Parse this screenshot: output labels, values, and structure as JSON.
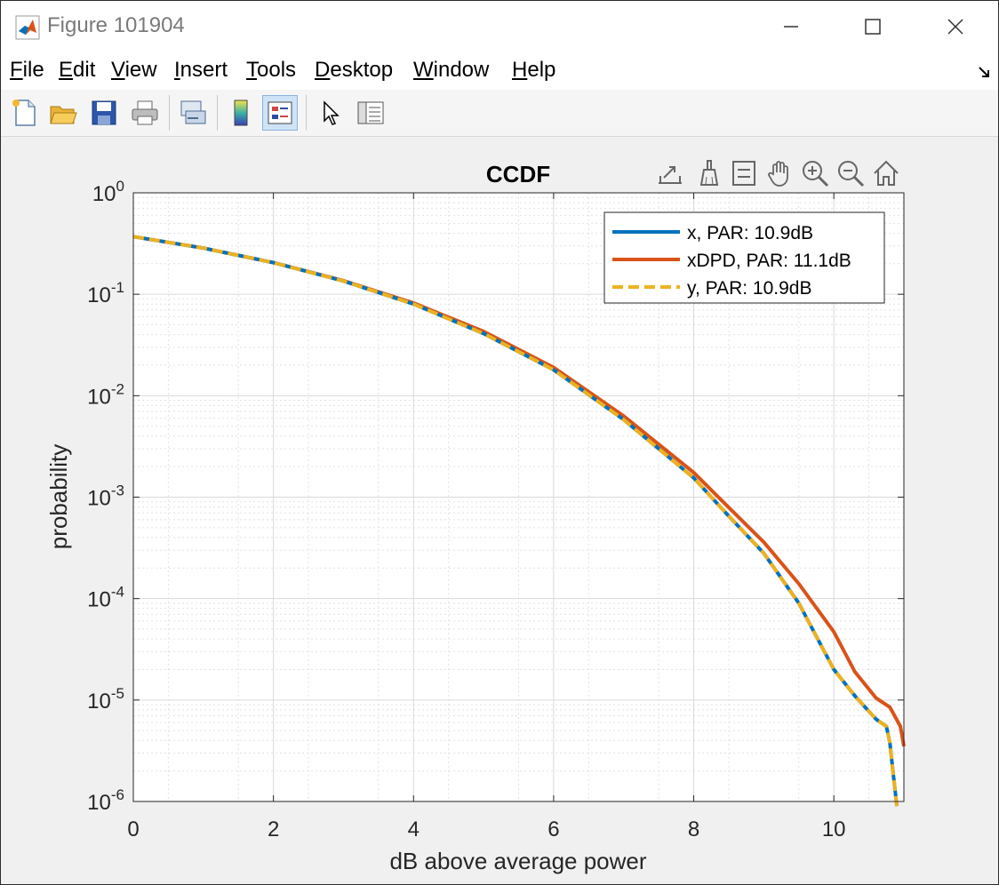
{
  "window": {
    "title": "Figure 101904",
    "controls": {
      "minimize": "minimize",
      "maximize": "maximize",
      "close": "close"
    }
  },
  "menu": [
    {
      "label": "File",
      "u": "F",
      "rest": "ile"
    },
    {
      "label": "Edit",
      "u": "E",
      "rest": "dit"
    },
    {
      "label": "View",
      "u": "V",
      "rest": "iew"
    },
    {
      "label": "Insert",
      "u": "I",
      "rest": "nsert"
    },
    {
      "label": "Tools",
      "u": "T",
      "rest": "ools"
    },
    {
      "label": "Desktop",
      "u": "D",
      "rest": "esktop"
    },
    {
      "label": "Window",
      "u": "W",
      "rest": "indow"
    },
    {
      "label": "Help",
      "u": "H",
      "rest": "elp"
    }
  ],
  "toolbar": {
    "icons": [
      "new-figure-icon",
      "open-file-icon",
      "save-icon",
      "print-icon",
      "link-plot-icon",
      "colorbar-icon",
      "legend-icon",
      "edit-pointer-icon",
      "property-inspector-icon"
    ]
  },
  "axes_toolbar": {
    "icons": [
      "export-icon",
      "brush-icon",
      "data-tips-icon",
      "pan-icon",
      "zoom-in-icon",
      "zoom-out-icon",
      "home-icon"
    ]
  },
  "colors": {
    "x": "#0072BD",
    "xDPD": "#D95319",
    "y": "#EDB120",
    "grid": "#d9d9d9"
  },
  "chart_data": {
    "type": "line",
    "title": "CCDF",
    "xlabel": "dB above average power",
    "ylabel": "probability",
    "xlim": [
      0,
      11
    ],
    "ylim_log10": [
      -6,
      0
    ],
    "yscale": "log",
    "xticks": [
      "0",
      "2",
      "4",
      "6",
      "8",
      "10"
    ],
    "yticks": [
      {
        "base": "10",
        "exp": "0"
      },
      {
        "base": "10",
        "exp": "-1"
      },
      {
        "base": "10",
        "exp": "-2"
      },
      {
        "base": "10",
        "exp": "-3"
      },
      {
        "base": "10",
        "exp": "-4"
      },
      {
        "base": "10",
        "exp": "-5"
      },
      {
        "base": "10",
        "exp": "-6"
      }
    ],
    "grid": true,
    "minor_grid": true,
    "legend_position": "top-right",
    "series": [
      {
        "name": "x, PAR: 10.9dB",
        "style": "solid",
        "points": [
          [
            0,
            0.37
          ],
          [
            1,
            0.285
          ],
          [
            2,
            0.205
          ],
          [
            3,
            0.135
          ],
          [
            4,
            0.08
          ],
          [
            5,
            0.041
          ],
          [
            6,
            0.018
          ],
          [
            7,
            0.0058
          ],
          [
            8,
            0.00155
          ],
          [
            8.5,
            0.00065
          ],
          [
            9,
            0.00028
          ],
          [
            9.5,
            9e-05
          ],
          [
            10,
            2e-05
          ],
          [
            10.3,
            1.1e-05
          ],
          [
            10.6,
            6.5e-06
          ],
          [
            10.75,
            5.5e-06
          ],
          [
            10.8,
            3.8e-06
          ],
          [
            10.85,
            1.8e-06
          ],
          [
            10.9,
            9e-07
          ]
        ]
      },
      {
        "name": "xDPD, PAR: 11.1dB",
        "style": "solid",
        "points": [
          [
            0,
            0.37
          ],
          [
            1,
            0.285
          ],
          [
            2,
            0.205
          ],
          [
            3,
            0.136
          ],
          [
            4,
            0.082
          ],
          [
            5,
            0.043
          ],
          [
            6,
            0.019
          ],
          [
            7,
            0.0063
          ],
          [
            8,
            0.00175
          ],
          [
            8.5,
            0.00079
          ],
          [
            9,
            0.00036
          ],
          [
            9.5,
            0.00014
          ],
          [
            10,
            4.7e-05
          ],
          [
            10.3,
            1.9e-05
          ],
          [
            10.6,
            1.05e-05
          ],
          [
            10.8,
            8.5e-06
          ],
          [
            10.95,
            5.5e-06
          ],
          [
            11,
            3.5e-06
          ]
        ]
      },
      {
        "name": "y, PAR: 10.9dB",
        "style": "dashed",
        "points": [
          [
            0,
            0.37
          ],
          [
            1,
            0.285
          ],
          [
            2,
            0.205
          ],
          [
            3,
            0.135
          ],
          [
            4,
            0.08
          ],
          [
            5,
            0.041
          ],
          [
            6,
            0.018
          ],
          [
            7,
            0.0058
          ],
          [
            8,
            0.00155
          ],
          [
            8.5,
            0.00065
          ],
          [
            9,
            0.00028
          ],
          [
            9.5,
            9e-05
          ],
          [
            10,
            2e-05
          ],
          [
            10.3,
            1.1e-05
          ],
          [
            10.6,
            6.5e-06
          ],
          [
            10.75,
            5.5e-06
          ],
          [
            10.8,
            3.8e-06
          ],
          [
            10.85,
            1.8e-06
          ],
          [
            10.9,
            9e-07
          ]
        ]
      }
    ]
  }
}
